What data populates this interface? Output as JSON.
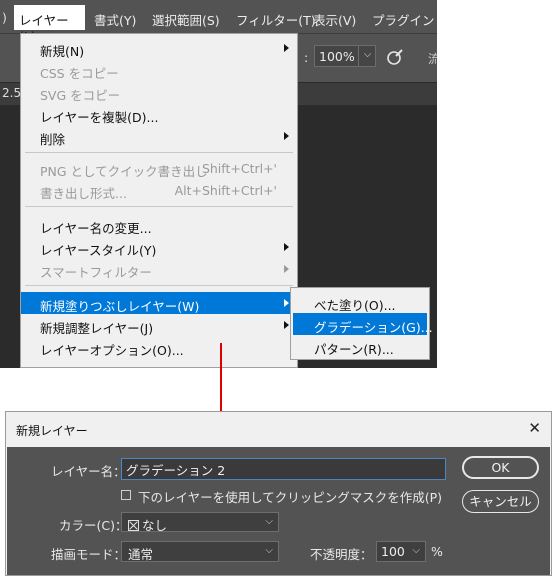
{
  "menubar": {
    "left_trunc": ")",
    "items": [
      "レイヤー(L)",
      "書式(Y)",
      "選択範囲(S)",
      "フィルター(T)",
      "表示(V)",
      "プラグイン"
    ]
  },
  "options_bar": {
    "zoom_prefix": ":",
    "zoom": "100%",
    "right_trunc": "流",
    "left_trunc": "2.5"
  },
  "layer_menu": {
    "items": [
      {
        "label": "新規(N)",
        "shortcut": "",
        "submenu": true,
        "disabled": false
      },
      {
        "label": "CSS をコピー",
        "shortcut": "",
        "submenu": false,
        "disabled": true
      },
      {
        "label": "SVG をコピー",
        "shortcut": "",
        "submenu": false,
        "disabled": true
      },
      {
        "label": "レイヤーを複製(D)...",
        "shortcut": "",
        "submenu": false,
        "disabled": false
      },
      {
        "label": "削除",
        "shortcut": "",
        "submenu": true,
        "disabled": false
      },
      {
        "label": "PNG としてクイック書き出し",
        "shortcut": "Shift+Ctrl+'",
        "submenu": false,
        "disabled": true
      },
      {
        "label": "書き出し形式...",
        "shortcut": "Alt+Shift+Ctrl+'",
        "submenu": false,
        "disabled": true
      },
      {
        "label": "レイヤー名の変更...",
        "shortcut": "",
        "submenu": false,
        "disabled": false
      },
      {
        "label": "レイヤースタイル(Y)",
        "shortcut": "",
        "submenu": true,
        "disabled": false
      },
      {
        "label": "スマートフィルター",
        "shortcut": "",
        "submenu": true,
        "disabled": true
      },
      {
        "label": "新規塗りつぶしレイヤー(W)",
        "shortcut": "",
        "submenu": true,
        "disabled": false,
        "highlighted": true
      },
      {
        "label": "新規調整レイヤー(J)",
        "shortcut": "",
        "submenu": true,
        "disabled": false
      },
      {
        "label": "レイヤーオプション(O)...",
        "shortcut": "",
        "submenu": false,
        "disabled": false
      }
    ]
  },
  "fill_submenu": {
    "items": [
      {
        "label": "べた塗り(O)...",
        "highlighted": false
      },
      {
        "label": "グラデーション(G)...",
        "highlighted": true
      },
      {
        "label": "パターン(R)...",
        "highlighted": false
      }
    ]
  },
  "dialog": {
    "title": "新規レイヤー",
    "close": "✕",
    "name_label": "レイヤー名：",
    "name_value": "グラデーション 2",
    "clip_label": "下のレイヤーを使用してクリッピングマスクを作成(P)",
    "color_label": "カラー(C)：",
    "color_value": "なし",
    "mode_label": "描画モード：",
    "mode_value": "通常",
    "opacity_label": "不透明度：",
    "opacity_value": "100",
    "opacity_unit": "%",
    "ok": "OK",
    "cancel": "キャンセル"
  },
  "colors": {
    "highlight": "#0078d7",
    "arrow": "#e00000",
    "ps_panel": "#535353"
  }
}
